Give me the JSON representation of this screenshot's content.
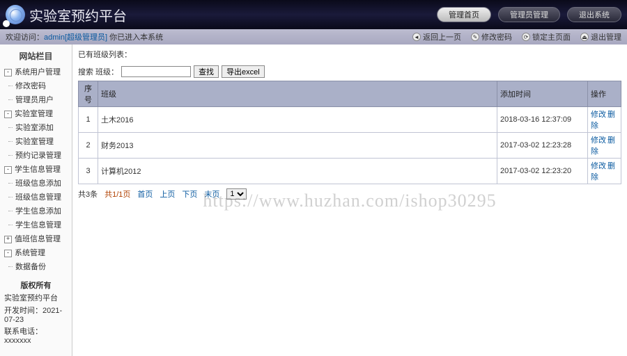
{
  "header": {
    "title": "实验室预约平台",
    "buttons": [
      {
        "label": "管理首页",
        "active": true
      },
      {
        "label": "管理员管理",
        "active": false
      },
      {
        "label": "退出系统",
        "active": false
      }
    ]
  },
  "subbar": {
    "welcome_prefix": "欢迎访问：",
    "user": "admin",
    "role": "[超级管理员]",
    "welcome_suffix": " 你已进入本系统",
    "actions": [
      {
        "label": "返回上一页"
      },
      {
        "label": "修改密码"
      },
      {
        "label": "锁定主页面"
      },
      {
        "label": "退出管理"
      }
    ]
  },
  "sidebar": {
    "title": "网站栏目",
    "groups": [
      {
        "label": "系统用户管理",
        "state": "expanded",
        "items": [
          "修改密码",
          "管理员用户"
        ]
      },
      {
        "label": "实验室管理",
        "state": "expanded",
        "items": [
          "实验室添加",
          "实验室管理",
          "预约记录管理"
        ]
      },
      {
        "label": "学生信息管理",
        "state": "expanded",
        "items": [
          "班级信息添加",
          "班级信息管理",
          "学生信息添加",
          "学生信息管理"
        ]
      },
      {
        "label": "值班信息管理",
        "state": "collapsed",
        "items": []
      },
      {
        "label": "系统管理",
        "state": "expanded",
        "items": [
          "数据备份"
        ]
      }
    ],
    "footer_heading": "版权所有",
    "info": {
      "site": "实验室预约平台",
      "dev_label": "开发时间：",
      "dev_value": "2021-07-23",
      "contact_label": "联系电话：",
      "contact_value": "xxxxxxx"
    }
  },
  "main": {
    "crumb": "已有班级列表：",
    "search": {
      "label": "搜索  班级：",
      "value": "",
      "submit": "查找",
      "export": "导出excel"
    },
    "table": {
      "headers": {
        "seq": "序号",
        "name": "班级",
        "time": "添加时间",
        "ops": "操作"
      },
      "rows": [
        {
          "seq": "1",
          "name": "土木2016",
          "time": "2018-03-16 12:37:09"
        },
        {
          "seq": "2",
          "name": "财务2013",
          "time": "2017-03-02 12:23:28"
        },
        {
          "seq": "3",
          "name": "计算机2012",
          "time": "2017-03-02 12:23:20"
        }
      ],
      "op_edit": "修改",
      "op_delete": "删除"
    },
    "pager": {
      "total": "共3条",
      "pages": "共1/1页",
      "first": "首页",
      "prev": "上页",
      "next": "下页",
      "last": "末页",
      "select": "1"
    }
  },
  "watermark": "https://www.huzhan.com/ishop30295"
}
